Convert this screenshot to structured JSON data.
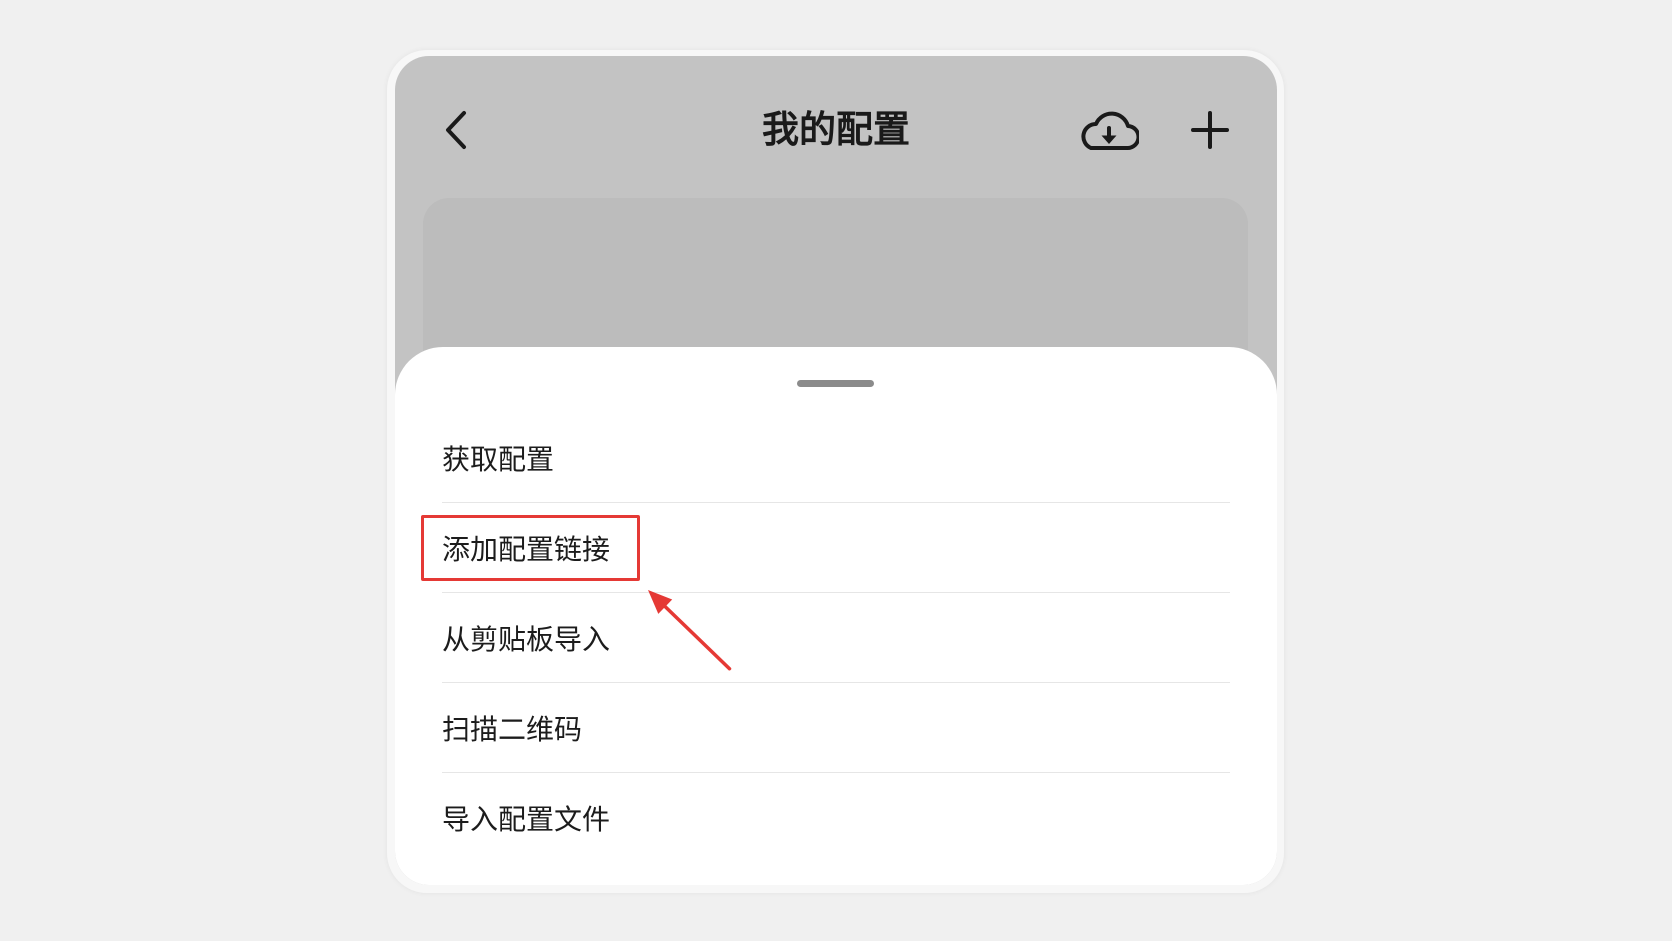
{
  "header": {
    "title": "我的配置",
    "back_icon": "chevron-left-icon",
    "cloud_icon": "cloud-download-icon",
    "add_icon": "plus-icon"
  },
  "sheet": {
    "items": [
      {
        "label": "获取配置",
        "highlighted": false
      },
      {
        "label": "添加配置链接",
        "highlighted": true
      },
      {
        "label": "从剪贴板导入",
        "highlighted": false
      },
      {
        "label": "扫描二维码",
        "highlighted": false
      },
      {
        "label": "导入配置文件",
        "highlighted": false
      }
    ]
  },
  "colors": {
    "page_background": "#f0f0f0",
    "dim_overlay": "#c3c3c3",
    "sheet_background": "#ffffff",
    "text": "#1c1c1c",
    "annotation_red": "#e53935"
  }
}
